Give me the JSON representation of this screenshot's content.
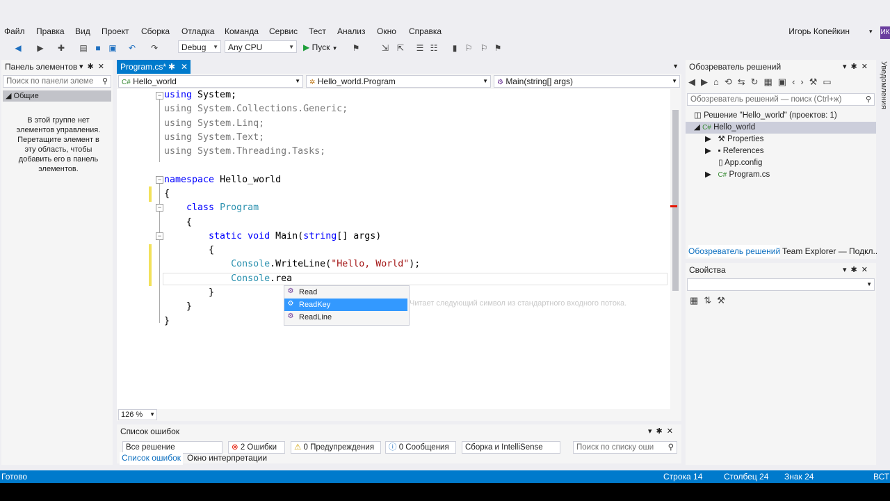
{
  "menu": [
    "Файл",
    "Правка",
    "Вид",
    "Проект",
    "Сборка",
    "Отладка",
    "Команда",
    "Сервис",
    "Тест",
    "Анализ",
    "Окно",
    "Справка"
  ],
  "user": {
    "name": "Игорь Копейкин",
    "avatar": "ИК"
  },
  "toolbar": {
    "config": "Debug",
    "platform": "Any CPU",
    "start_label": "Пуск"
  },
  "toolbox": {
    "title": "Панель элементов",
    "search_placeholder": "Поиск по панели элеме",
    "group": "Общие",
    "empty_text": "В этой группе нет элементов управления. Перетащите элемент в эту область, чтобы добавить его в панель элементов."
  },
  "editor": {
    "tab": "Program.cs*",
    "nav": [
      "Hello_world",
      "Hello_world.Program",
      "Main(string[] args)"
    ],
    "zoom": "126 %",
    "lines": [
      {
        "parts": [
          {
            "t": "using",
            "c": "kw"
          },
          {
            "t": " System;",
            "c": ""
          }
        ]
      },
      {
        "parts": [
          {
            "t": "using",
            "c": "kw-dim"
          },
          {
            "t": " System.Collections.Generic;",
            "c": "kw-dim"
          }
        ]
      },
      {
        "parts": [
          {
            "t": "using",
            "c": "kw-dim"
          },
          {
            "t": " System.Linq;",
            "c": "kw-dim"
          }
        ]
      },
      {
        "parts": [
          {
            "t": "using",
            "c": "kw-dim"
          },
          {
            "t": " System.Text;",
            "c": "kw-dim"
          }
        ]
      },
      {
        "parts": [
          {
            "t": "using",
            "c": "kw-dim"
          },
          {
            "t": " System.Threading.Tasks;",
            "c": "kw-dim"
          }
        ]
      },
      {
        "parts": []
      },
      {
        "parts": [
          {
            "t": "namespace",
            "c": "kw"
          },
          {
            "t": " Hello_world",
            "c": ""
          }
        ]
      },
      {
        "parts": [
          {
            "t": "{",
            "c": ""
          }
        ]
      },
      {
        "parts": [
          {
            "t": "    ",
            "c": ""
          },
          {
            "t": "class",
            "c": "kw"
          },
          {
            "t": " ",
            "c": ""
          },
          {
            "t": "Program",
            "c": "cls"
          }
        ]
      },
      {
        "parts": [
          {
            "t": "    {",
            "c": ""
          }
        ]
      },
      {
        "parts": [
          {
            "t": "        ",
            "c": ""
          },
          {
            "t": "static",
            "c": "kw"
          },
          {
            "t": " ",
            "c": ""
          },
          {
            "t": "void",
            "c": "kw"
          },
          {
            "t": " Main(",
            "c": ""
          },
          {
            "t": "string",
            "c": "kw"
          },
          {
            "t": "[] args)",
            "c": ""
          }
        ]
      },
      {
        "parts": [
          {
            "t": "        {",
            "c": ""
          }
        ]
      },
      {
        "parts": [
          {
            "t": "            ",
            "c": ""
          },
          {
            "t": "Console",
            "c": "cls"
          },
          {
            "t": ".WriteLine(",
            "c": ""
          },
          {
            "t": "\"Hello, World\"",
            "c": "str"
          },
          {
            "t": ");",
            "c": ""
          }
        ]
      },
      {
        "parts": [
          {
            "t": "            ",
            "c": ""
          },
          {
            "t": "Console",
            "c": "cls"
          },
          {
            "t": ".rea",
            "c": ""
          }
        ]
      },
      {
        "parts": [
          {
            "t": "        }",
            "c": ""
          }
        ]
      },
      {
        "parts": [
          {
            "t": "    }",
            "c": ""
          }
        ]
      },
      {
        "parts": [
          {
            "t": "}",
            "c": ""
          }
        ]
      }
    ],
    "completions": [
      "Read",
      "ReadKey",
      "ReadLine"
    ],
    "completion_tooltip": "Читает следующий символ из стандартного входного потока."
  },
  "errorlist": {
    "title": "Список ошибок",
    "scope": "Все решение",
    "errors": "2 Ошибки",
    "warnings": "0 Предупреждения",
    "messages": "0 Сообщения",
    "source": "Сборка и IntelliSense",
    "search_placeholder": "Поиск по списку оши"
  },
  "bottom_tabs": [
    "Список ошибок",
    "Окно интерпретации"
  ],
  "solution": {
    "title": "Обозреватель решений",
    "search_placeholder": "Обозреватель решений — поиск (Ctrl+ж)",
    "root": "Решение \"Hello_world\" (проектов: 1)",
    "project": "Hello_world",
    "items": [
      "Properties",
      "References",
      "App.config",
      "Program.cs"
    ],
    "tabs": [
      "Обозреватель решений",
      "Team Explorer — Подкл..."
    ]
  },
  "properties": {
    "title": "Свойства"
  },
  "notifications_label": "Уведомления",
  "status": {
    "ready": "Готово",
    "row": "Строка 14",
    "col": "Столбец 24",
    "ch": "Знак 24",
    "mode": "ВСТ"
  }
}
